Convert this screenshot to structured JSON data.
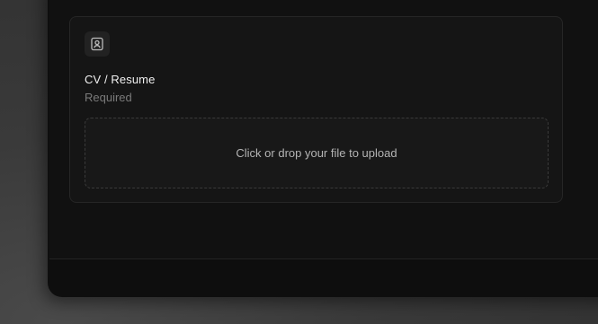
{
  "upload_card": {
    "icon": "user-document-icon",
    "title": "CV / Resume",
    "subtitle": "Required",
    "dropzone_text": "Click or drop your file to upload"
  },
  "colors": {
    "background": "#3a3a3a",
    "panel": "#0e0e0e",
    "card": "#151515",
    "title_text": "#f0f0f0",
    "muted_text": "#7a7a7a"
  }
}
